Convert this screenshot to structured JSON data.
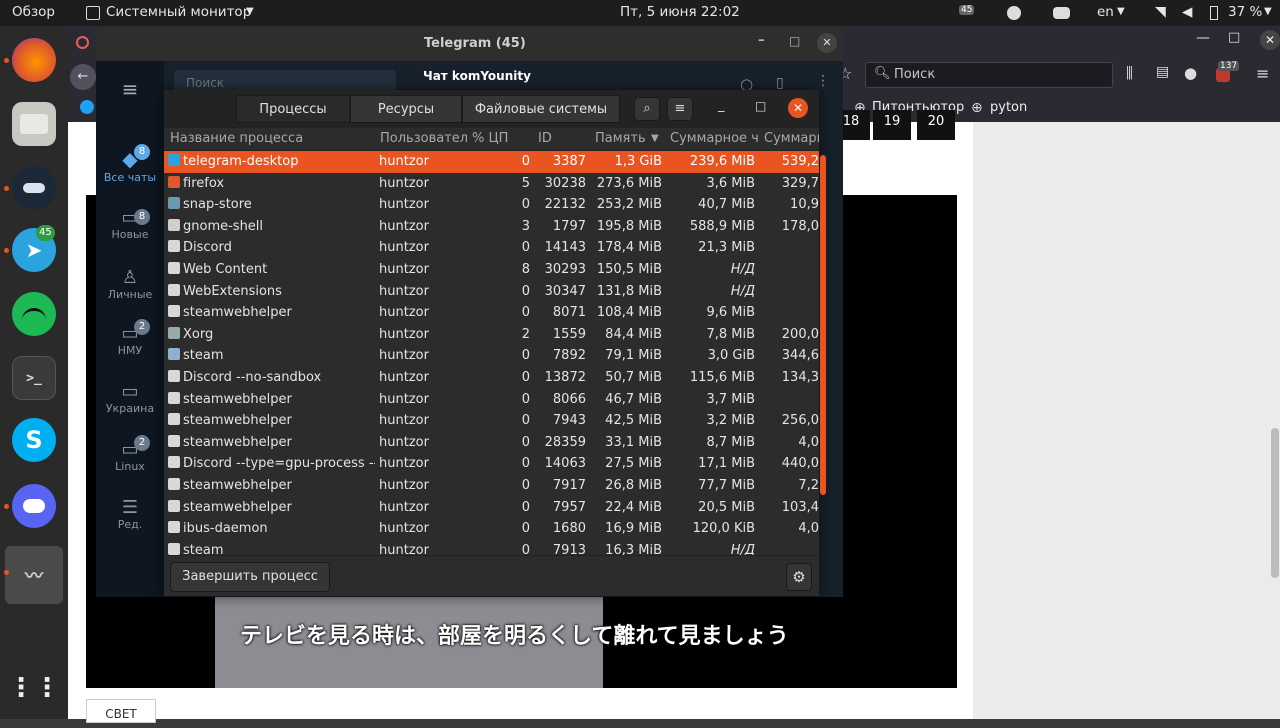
{
  "topbar": {
    "overview": "Обзор",
    "app": "Системный монитор",
    "datetime": "Пт, 5 июня  22:02",
    "badge": "45",
    "lang": "en",
    "battery": "37 %"
  },
  "dock": {
    "telegram_badge": "45"
  },
  "browser": {
    "search_placeholder": "Поиск",
    "bookmark1": "Питонтьютор",
    "bookmark2": "pyton",
    "pages": [
      "18",
      "19",
      "20"
    ],
    "ext_badge": "137",
    "bottom_button": "СВЕТ",
    "subtitle": "テレビを見る時は、部屋を明るくして離れて見ましょう"
  },
  "telegram": {
    "title": "Telegram (45)",
    "search_placeholder": "Поиск",
    "chat_title": "Чат komYounity",
    "folders": [
      {
        "label": "Все чаты",
        "badge": "8"
      },
      {
        "label": "Новые",
        "badge": "8"
      },
      {
        "label": "Личные",
        "badge": ""
      },
      {
        "label": "НМУ",
        "badge": "2"
      },
      {
        "label": "Украина",
        "badge": ""
      },
      {
        "label": "Linux",
        "badge": "2"
      },
      {
        "label": "Ред.",
        "badge": ""
      }
    ]
  },
  "sysmon": {
    "tabs": [
      "Процессы",
      "Ресурсы",
      "Файловые системы"
    ],
    "columns": [
      "Название процесса",
      "Пользовател",
      "% ЦП",
      "ID",
      "Память",
      "Суммарное ч",
      "Суммарн"
    ],
    "kill_button": "Завершить процесс",
    "rows": [
      [
        "telegram-desktop",
        "huntzor",
        "0",
        "3387",
        "1,3 GiB",
        "239,6 MiB",
        "539,2"
      ],
      [
        "firefox",
        "huntzor",
        "5",
        "30238",
        "273,6 MiB",
        "3,6 MiB",
        "329,7"
      ],
      [
        "snap-store",
        "huntzor",
        "0",
        "22132",
        "253,2 MiB",
        "40,7 MiB",
        "10,9"
      ],
      [
        "gnome-shell",
        "huntzor",
        "3",
        "1797",
        "195,8 MiB",
        "588,9 MiB",
        "178,0"
      ],
      [
        "Discord",
        "huntzor",
        "0",
        "14143",
        "178,4 MiB",
        "21,3 MiB",
        ""
      ],
      [
        "Web Content",
        "huntzor",
        "8",
        "30293",
        "150,5 MiB",
        "Н/Д",
        ""
      ],
      [
        "WebExtensions",
        "huntzor",
        "0",
        "30347",
        "131,8 MiB",
        "Н/Д",
        ""
      ],
      [
        "steamwebhelper",
        "huntzor",
        "0",
        "8071",
        "108,4 MiB",
        "9,6 MiB",
        ""
      ],
      [
        "Xorg",
        "huntzor",
        "2",
        "1559",
        "84,4 MiB",
        "7,8 MiB",
        "200,0"
      ],
      [
        "steam",
        "huntzor",
        "0",
        "7892",
        "79,1 MiB",
        "3,0 GiB",
        "344,6"
      ],
      [
        "Discord --no-sandbox",
        "huntzor",
        "0",
        "13872",
        "50,7 MiB",
        "115,6 MiB",
        "134,3"
      ],
      [
        "steamwebhelper",
        "huntzor",
        "0",
        "8066",
        "46,7 MiB",
        "3,7 MiB",
        ""
      ],
      [
        "steamwebhelper",
        "huntzor",
        "0",
        "7943",
        "42,5 MiB",
        "3,2 MiB",
        "256,0"
      ],
      [
        "steamwebhelper",
        "huntzor",
        "0",
        "28359",
        "33,1 MiB",
        "8,7 MiB",
        "4,0"
      ],
      [
        "Discord --type=gpu-process --fi",
        "huntzor",
        "0",
        "14063",
        "27,5 MiB",
        "17,1 MiB",
        "440,0"
      ],
      [
        "steamwebhelper",
        "huntzor",
        "0",
        "7917",
        "26,8 MiB",
        "77,7 MiB",
        "7,2"
      ],
      [
        "steamwebhelper",
        "huntzor",
        "0",
        "7957",
        "22,4 MiB",
        "20,5 MiB",
        "103,4"
      ],
      [
        "ibus-daemon",
        "huntzor",
        "0",
        "1680",
        "16,9 MiB",
        "120,0 KiB",
        "4,0"
      ],
      [
        "steam",
        "huntzor",
        "0",
        "7913",
        "16,3 MiB",
        "Н/Д",
        ""
      ]
    ]
  }
}
